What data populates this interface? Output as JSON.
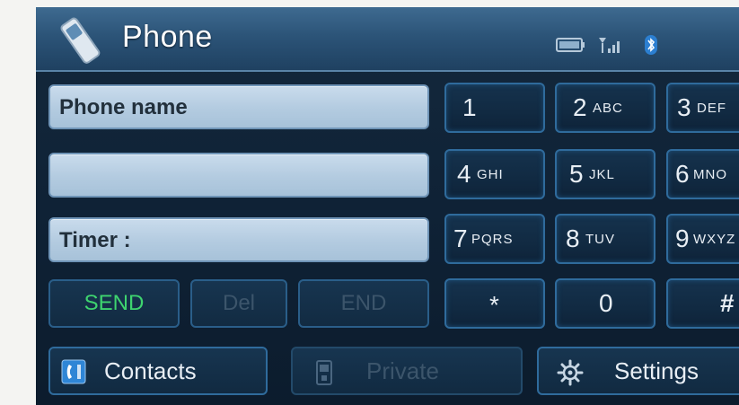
{
  "header": {
    "title": "Phone",
    "icons": [
      "phone-handset-icon",
      "battery-icon",
      "signal-strength-icon",
      "bluetooth-icon"
    ]
  },
  "fields": {
    "phone_name": "Phone name",
    "number": "",
    "timer": "Timer :"
  },
  "keypad": [
    {
      "digit": "1",
      "letters": ""
    },
    {
      "digit": "2",
      "letters": "ABC"
    },
    {
      "digit": "3",
      "letters": "DEF"
    },
    {
      "digit": "4",
      "letters": "GHI"
    },
    {
      "digit": "5",
      "letters": "JKL"
    },
    {
      "digit": "6",
      "letters": "MNO"
    },
    {
      "digit": "7",
      "letters": "PQRS"
    },
    {
      "digit": "8",
      "letters": "TUV"
    },
    {
      "digit": "9",
      "letters": "WXYZ"
    },
    {
      "digit": "*",
      "letters": ""
    },
    {
      "digit": "0",
      "letters": ""
    },
    {
      "digit": "#",
      "letters": ""
    }
  ],
  "actions": {
    "send": "SEND",
    "del": "Del",
    "end": "END"
  },
  "bottom": {
    "contacts": "Contacts",
    "private": "Private",
    "settings": "Settings"
  },
  "colors": {
    "send_active": "#3ed46f",
    "disabled_text": "#3c556b",
    "key_border": "#2f6b9c"
  }
}
